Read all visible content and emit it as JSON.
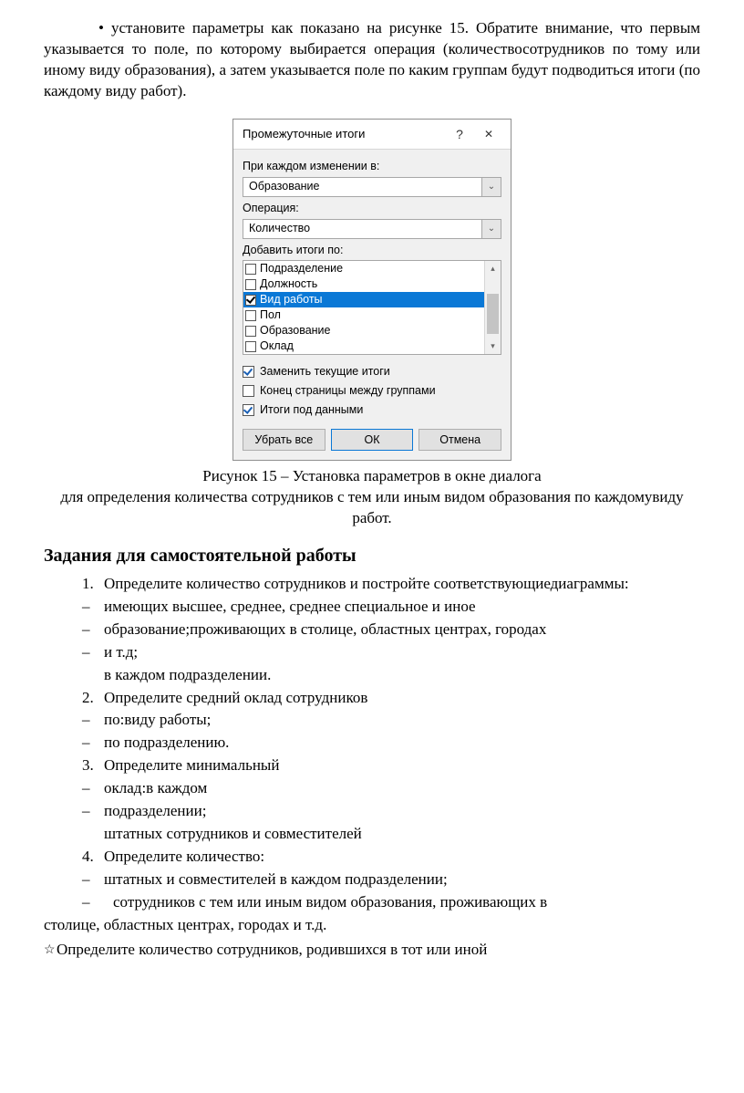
{
  "intro": "установите параметры как показано на рисунке 15. Обратите внимание, что первым указывается то поле, по которому выбирается операция (количествосотрудников по тому или иному виду образования), а затем указывается поле по каким группам будут подводиться итоги (по каждому виду работ).",
  "dialog": {
    "title": "Промежуточные итоги",
    "help": "?",
    "close": "✕",
    "label_change": "При каждом изменении в:",
    "select_change": "Образование",
    "label_op": "Операция:",
    "select_op": "Количество",
    "label_add": "Добавить итоги по:",
    "items": [
      {
        "label": "Подразделение",
        "checked": false,
        "selected": false
      },
      {
        "label": "Должность",
        "checked": false,
        "selected": false
      },
      {
        "label": "Вид работы",
        "checked": true,
        "selected": true
      },
      {
        "label": "Пол",
        "checked": false,
        "selected": false
      },
      {
        "label": "Образование",
        "checked": false,
        "selected": false
      },
      {
        "label": "Оклад",
        "checked": false,
        "selected": false
      }
    ],
    "opt_replace": "Заменить текущие итоги",
    "opt_pagebreak": "Конец страницы между группами",
    "opt_below": "Итоги под данными",
    "btn_remove": "Убрать все",
    "btn_ok": "ОК",
    "btn_cancel": "Отмена"
  },
  "caption1": "Рисунок 15 – Установка параметров в окне диалога",
  "caption2": "для определения количества сотрудников с тем или иным видом образования по каждомувиду работ.",
  "tasks_heading": "Задания для самостоятельной работы",
  "t": {
    "l1": "Определите количество сотрудников и постройте соответствующиедиаграммы:",
    "l2": "имеющих высшее, среднее, среднее специальное и иное",
    "l3": "образование;проживающих в столице, областных центрах, городах",
    "l4": "и т.д;",
    "l5": "в каждом подразделении.",
    "l6": "Определите средний оклад сотрудников",
    "l7": "по:виду работы;",
    "l8": "по подразделению.",
    "l9": "Определите минимальный",
    "l10": "оклад:в каждом",
    "l11": "подразделении;",
    "l12": "штатных сотрудников и совместителей",
    "l13": "Определите количество:",
    "l14": "штатных и совместителей в каждом подразделении;",
    "l15a": "сотрудников с тем или иным видом образования, проживающих в",
    "l15b": "столице, областных центрах, городах и т.д."
  },
  "final": "Определите количество сотрудников, родившихся в тот или иной"
}
